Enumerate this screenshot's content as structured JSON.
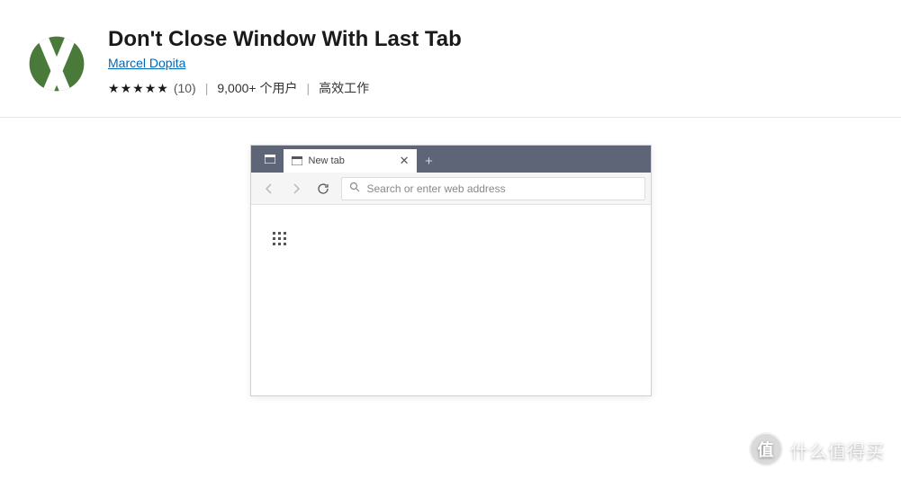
{
  "extension": {
    "title": "Don't Close Window With Last Tab",
    "author": "Marcel Dopita",
    "rating_count": "(10)",
    "users": "9,000+ 个用户",
    "category": "高效工作"
  },
  "mock_browser": {
    "tab_label": "New tab",
    "address_placeholder": "Search or enter web address"
  },
  "watermark": {
    "badge": "值",
    "text": "什么值得买"
  }
}
